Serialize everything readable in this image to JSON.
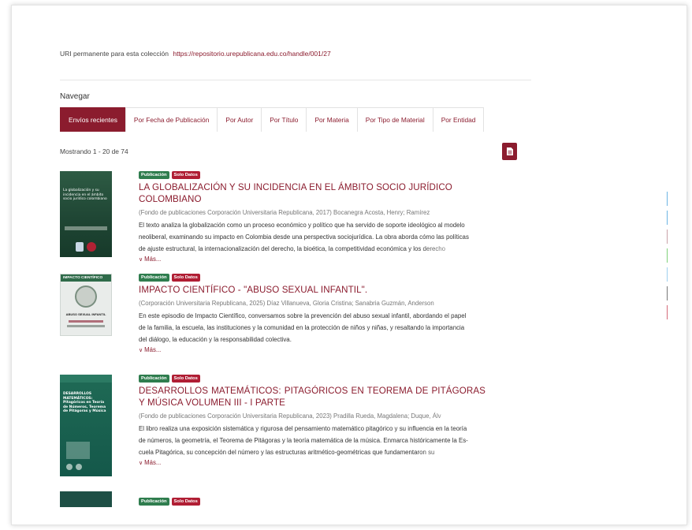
{
  "uri": {
    "label": "URI permanente para esta colección",
    "link": "https://repositorio.urepublicana.edu.co/handle/001/27"
  },
  "browse": {
    "label": "Navegar",
    "tabs": [
      {
        "label": "Envíos recientes",
        "active": true
      },
      {
        "label": "Por Fecha de Publicación",
        "active": false
      },
      {
        "label": "Por Autor",
        "active": false
      },
      {
        "label": "Por Título",
        "active": false
      },
      {
        "label": "Por Materia",
        "active": false
      },
      {
        "label": "Por Tipo de Material",
        "active": false
      },
      {
        "label": "Por Entidad",
        "active": false
      }
    ]
  },
  "results": {
    "count_text": "Mostrando 1 - 20 de 74",
    "export_icon": "file-icon"
  },
  "items": [
    {
      "badges": [
        "Publicación",
        "Solo Datos"
      ],
      "title": "LA GLOBALIZACIÓN Y SU INCIDENCIA EN EL ÁMBITO SOCIO JURÍDICO COLOMBIANO",
      "meta": "(Fondo de publicaciones Corporación Universitaria Republicana, 2017) Bocanegra Acosta, Henry; Ramírez",
      "abstract": [
        "El texto analiza la globalización como un proceso económico y político que ha servido de soporte ideológico al modelo",
        "neoliberal, examinando su impacto en Colombia desde una perspectiva sociojurídica. La obra aborda cómo las políticas",
        "de ajuste estructural, la internacionalización del derecho, la bioética, la competitividad económica y los derecho"
      ],
      "more": "Más...",
      "cover_text": "La globalización y su incidencia en el ámbito socio jurídico colombiano"
    },
    {
      "badges": [
        "Publicación",
        "Solo Datos"
      ],
      "title": "IMPACTO CIENTÍFICO - \"ABUSO SEXUAL INFANTIL\".",
      "meta": "(Corporación Universitaria Republicana, 2025) Díaz Villanueva, Gloria Cristina; Sanabria Guzmán, Anderson",
      "abstract": [
        "En este episodio de Impacto Científico, conversamos sobre la prevención del abuso sexual infantil, abordando el papel",
        "de la familia, la escuela, las instituciones y la comunidad en la protección de niños y niñas, y resaltando la importancia",
        "del diálogo, la educación y la responsabilidad colectiva."
      ],
      "more": "Más...",
      "cover_text": "IMPACTO CIENTÍFICO",
      "cover_sub": "ABUSO SEXUAL INFANTIL"
    },
    {
      "badges": [
        "Publicación",
        "Solo Datos"
      ],
      "title": "DESARROLLOS MATEMÁTICOS: PITAGÓRICOS EN TEOREMA DE PITÁGORAS Y MÚSICA VOLUMEN III - I PARTE",
      "meta": "(Fondo de publicaciones Corporación Universitaria Republicana, 2023) Pradilla Rueda, Magdalena; Duque, Álv",
      "abstract": [
        "El libro realiza una exposición sistemática y rigurosa del pensamiento matemático pitagórico y su influencia en la teoría",
        "de números, la geometría, el Teorema de Pitágoras y la teoría matemática de la música. Enmarca históricamente la Es-",
        "cuela Pitagórica, su concepción del número y las estructuras aritmético-geométricas que fundamentaron su"
      ],
      "more": "Más...",
      "cover_text": "DESARROLLOS MATEMÁTICOS: Pitagóricos en Teoría de Números, Teorema de Pitágoras y Música"
    },
    {
      "badges": [
        "Publicación",
        "Solo Datos"
      ]
    }
  ],
  "colors": {
    "brand": "#8b1c2e",
    "badge_pub": "#2f7d4e",
    "badge_data": "#b01e34"
  },
  "right_bars": [
    "#6cb4e4",
    "#6cb4e4",
    "#c9a2a8",
    "#7fd17a",
    "#9fd0ef",
    "#777777",
    "#d46a7a"
  ]
}
